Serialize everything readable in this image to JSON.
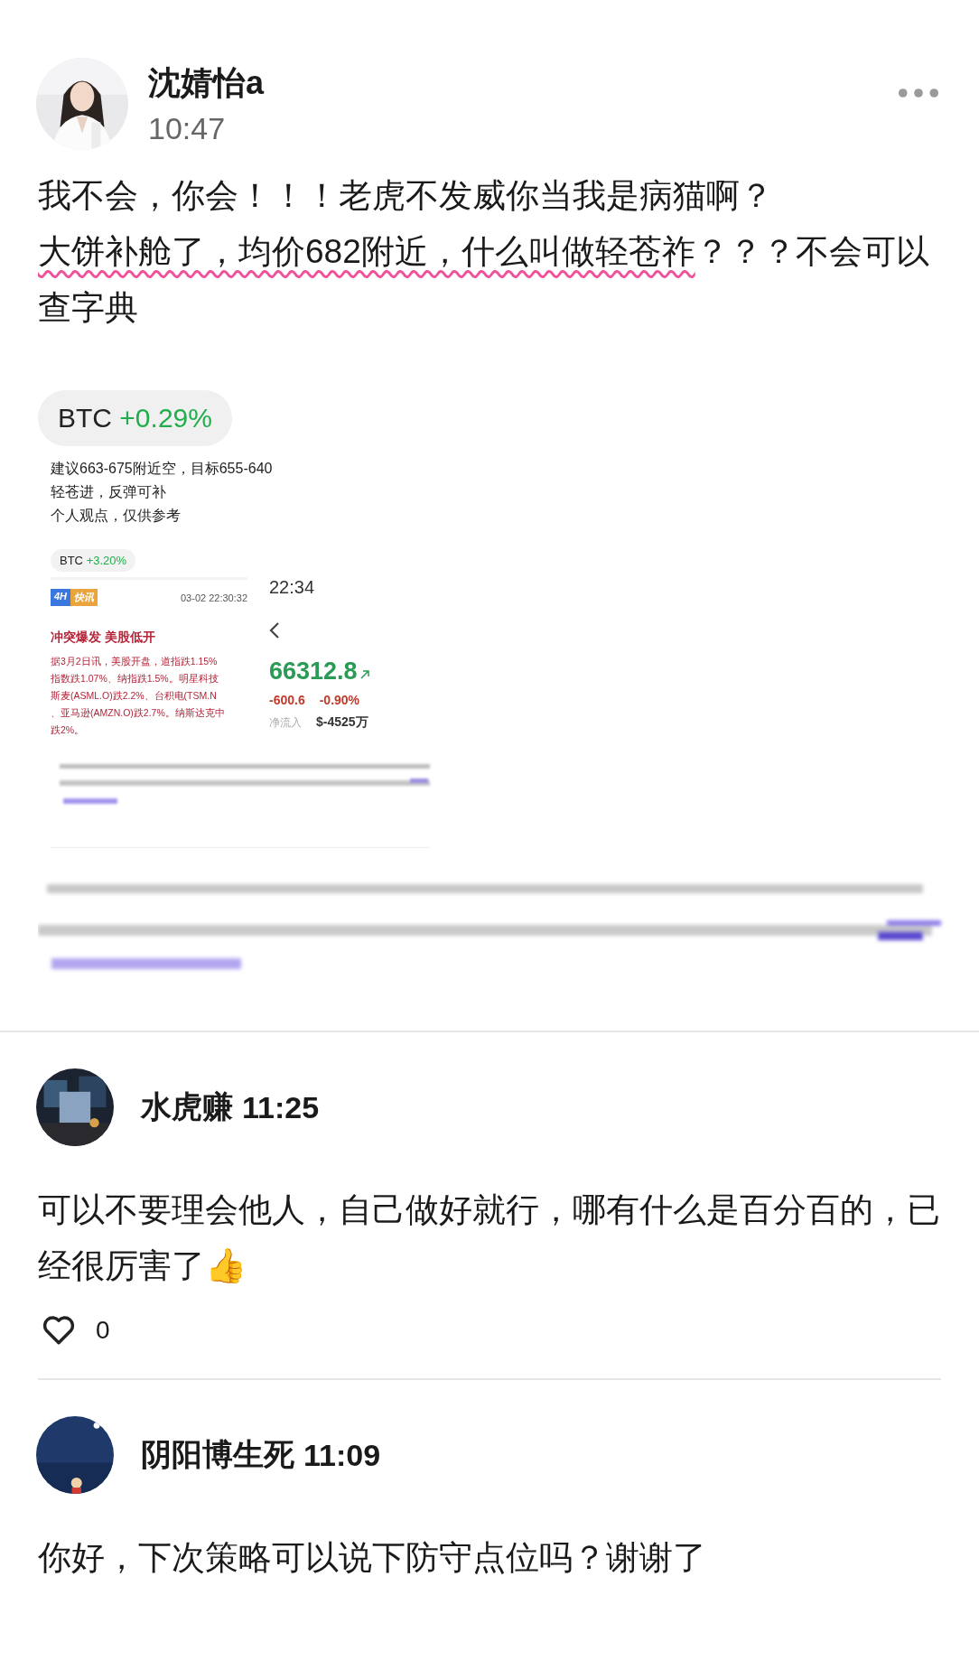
{
  "post": {
    "author": "沈婧怡a",
    "time": "10:47",
    "paragraphs": [
      {
        "segments": [
          {
            "text": "我不会，你会！！！老虎不发威你当我是病猫啊？",
            "underlined": false
          }
        ]
      },
      {
        "segments": [
          {
            "text": "大饼补舱了，均价682附近，什么叫做轻苍祚",
            "underlined": true
          },
          {
            "text": "？？？不会可以查字典",
            "underlined": false
          }
        ]
      }
    ],
    "attachment": {
      "chip": {
        "symbol": "BTC",
        "change": "+0.29%"
      },
      "caption_lines": [
        "建议663-675附近空，目标655-640",
        "轻苍进，反弹可补",
        "个人观点，仅供参考"
      ],
      "screenshot": {
        "chip": {
          "symbol": "BTC",
          "change": "+3.20%"
        },
        "news": {
          "badges": [
            {
              "text": "4H",
              "color": "#3a78e0"
            },
            {
              "text": "快讯",
              "color": "#e9a43b"
            }
          ],
          "timestamp": "03-02 22:30:32",
          "headline": "冲突爆发 美股低开",
          "lines": [
            "据3月2日讯，美股开盘，道指跌1.15%",
            "指数跌1.07%、纳指跌1.5%。明星科技",
            "斯麦(ASML.O)跌2.2%、台积电(TSM.N",
            "、亚马逊(AMZN.O)跌2.7%。纳斯达克中",
            "跌2%。"
          ]
        },
        "quote": {
          "time": "22:34",
          "price": "66312.8",
          "change": "-600.6",
          "change_pct": "-0.90%",
          "flow_label": "净流入",
          "flow_value": "$-4525万"
        }
      }
    }
  },
  "comments": [
    {
      "author": "水虎赚",
      "time": "11:25",
      "text": "可以不要理会他人，自己做好就行，哪有什么是百分百的，已经很厉害了👍",
      "likes": "0"
    },
    {
      "author": "阴阳博生死",
      "time": "11:09",
      "text": "你好，下次策略可以说下防守点位吗？谢谢了"
    }
  ]
}
